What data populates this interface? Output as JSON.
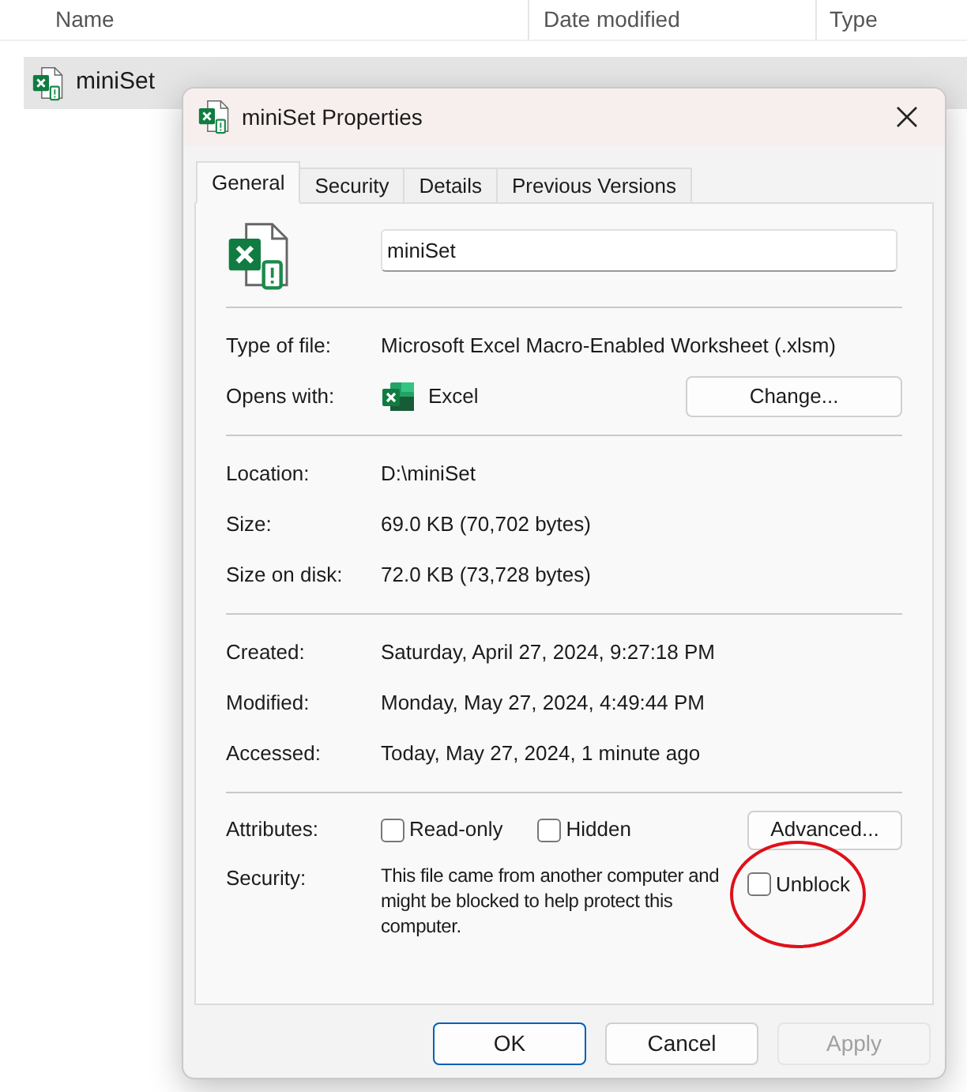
{
  "explorer": {
    "columns": [
      "Name",
      "Date modified",
      "Type"
    ],
    "rows": [
      {
        "name": "miniSet",
        "selected": true
      }
    ]
  },
  "dialog": {
    "title": "miniSet Properties",
    "tabs": [
      {
        "label": "General",
        "selected": true
      },
      {
        "label": "Security",
        "selected": false
      },
      {
        "label": "Details",
        "selected": false
      },
      {
        "label": "Previous Versions",
        "selected": false
      }
    ],
    "file_name": "miniSet",
    "groups": [
      [
        {
          "kind": "text",
          "label": "Type of file:",
          "value": "Microsoft Excel Macro-Enabled Worksheet (.xlsm)"
        },
        {
          "kind": "app",
          "label": "Opens with:",
          "value": "Excel",
          "button": "Change..."
        }
      ],
      [
        {
          "kind": "text",
          "label": "Location:",
          "value": "D:\\miniSet"
        },
        {
          "kind": "text",
          "label": "Size:",
          "value": "69.0 KB (70,702 bytes)"
        },
        {
          "kind": "text",
          "label": "Size on disk:",
          "value": "72.0 KB (73,728 bytes)"
        }
      ],
      [
        {
          "kind": "text",
          "label": "Created:",
          "value": "Saturday, April 27, 2024, 9:27:18 PM"
        },
        {
          "kind": "text",
          "label": "Modified:",
          "value": "Monday, May 27, 2024, 4:49:44 PM"
        },
        {
          "kind": "text",
          "label": "Accessed:",
          "value": "Today, May 27, 2024, 1 minute ago"
        }
      ]
    ],
    "attributes": {
      "label": "Attributes:",
      "options": [
        {
          "label": "Read-only",
          "checked": false
        },
        {
          "label": "Hidden",
          "checked": false
        }
      ],
      "button": "Advanced..."
    },
    "security": {
      "label": "Security:",
      "text": "This file came from another computer and might be blocked to help protect this computer.",
      "option": {
        "label": "Unblock",
        "checked": false
      },
      "highlighted": true
    },
    "buttons": [
      {
        "label": "OK",
        "kind": "primary"
      },
      {
        "label": "Cancel",
        "kind": "normal"
      },
      {
        "label": "Apply",
        "kind": "disabled"
      }
    ]
  }
}
